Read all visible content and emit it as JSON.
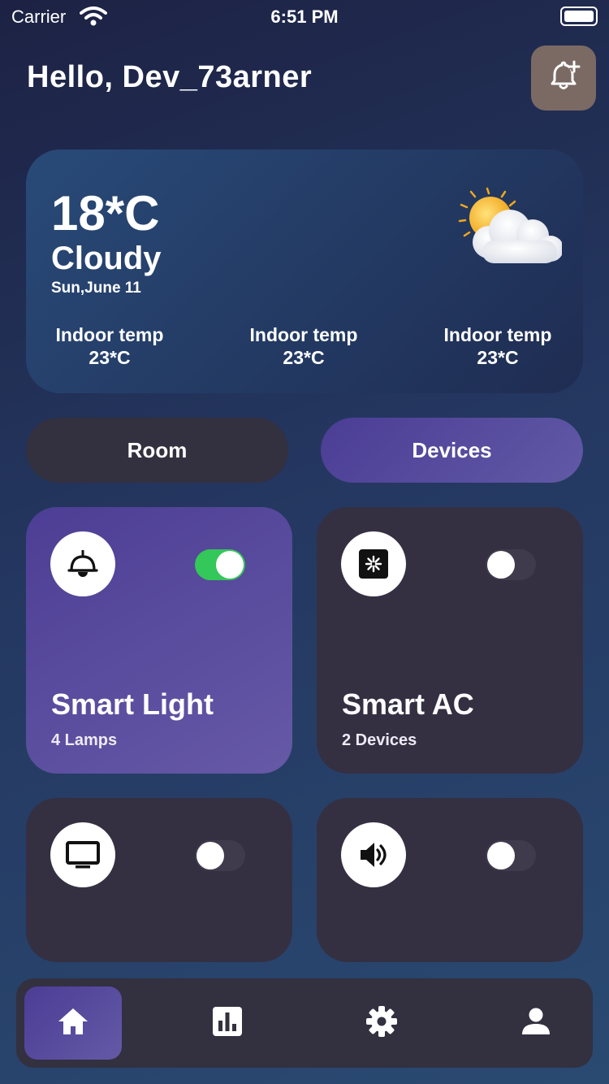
{
  "status_bar": {
    "carrier": "Carrier",
    "time": "6:51 PM"
  },
  "header": {
    "greeting": "Hello, Dev_73arner",
    "bell_icon": "bell-plus-icon"
  },
  "weather": {
    "temperature": "18*C",
    "condition": "Cloudy",
    "date": "Sun,June 11",
    "illustration": "sun-behind-cloud-icon",
    "stats": [
      {
        "label": "Indoor temp",
        "value": "23*C"
      },
      {
        "label": "Indoor temp",
        "value": "23*C"
      },
      {
        "label": "Indoor temp",
        "value": "23*C"
      }
    ]
  },
  "tabs": [
    {
      "label": "Room",
      "selected": false
    },
    {
      "label": "Devices",
      "selected": true
    }
  ],
  "devices": [
    {
      "name": "Smart Light",
      "subtitle": "4 Lamps",
      "icon": "ceiling-lamp-icon",
      "on": true
    },
    {
      "name": "Smart AC",
      "subtitle": "2 Devices",
      "icon": "air-conditioner-icon",
      "on": false
    },
    {
      "name": "",
      "subtitle": "",
      "icon": "tv-icon",
      "on": false
    },
    {
      "name": "",
      "subtitle": "",
      "icon": "speaker-icon",
      "on": false
    }
  ],
  "bottom_nav": [
    {
      "icon": "home-icon",
      "active": true
    },
    {
      "icon": "bar-chart-icon",
      "active": false
    },
    {
      "icon": "gear-icon",
      "active": false
    },
    {
      "icon": "person-icon",
      "active": false
    }
  ],
  "colors": {
    "accent_purple": "#5a4ba0",
    "card_dark": "#343042",
    "toggle_on": "#34c759",
    "bell_button": "#7b6a63"
  }
}
